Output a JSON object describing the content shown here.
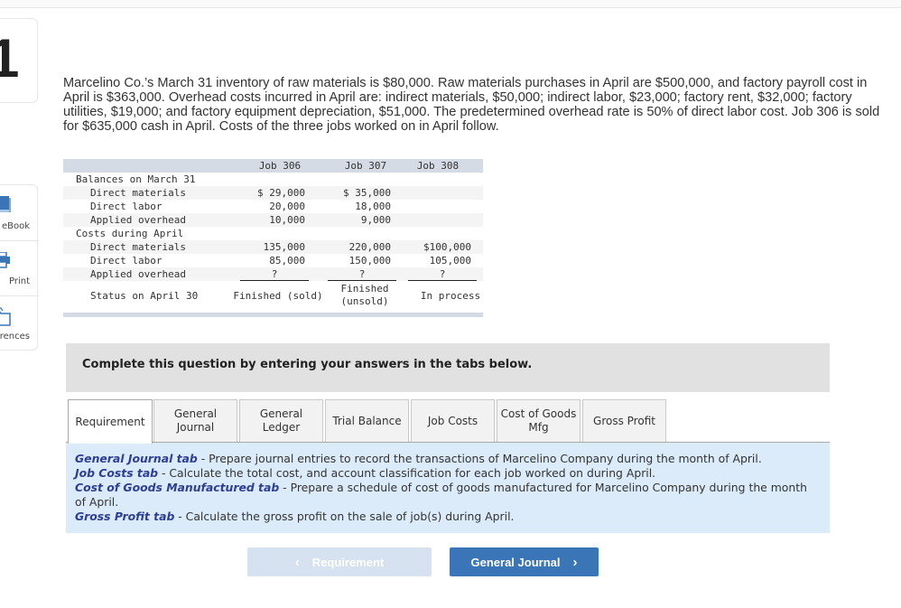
{
  "question": {
    "number": "1",
    "text": "Marcelino Co.’s March 31 inventory of raw materials is $80,000. Raw materials purchases in April are $500,000, and factory payroll cost in April is $363,000. Overhead costs incurred in April are: indirect materials, $50,000; indirect labor, $23,000; factory rent, $32,000; factory utilities, $19,000; and factory equipment depreciation, $51,000. The predetermined overhead rate is 50% of direct labor cost. Job 306 is sold for $635,000 cash in April. Costs of the three jobs worked on in April follow."
  },
  "side_tools": [
    {
      "label": "eBook",
      "icon": "book-icon"
    },
    {
      "label": "Print",
      "icon": "print-icon"
    },
    {
      "label": "References",
      "icon": "references-icon"
    }
  ],
  "job_table": {
    "headers": [
      "Job 306",
      "Job 307",
      "Job 308"
    ],
    "sections": [
      {
        "title": "Balances on March 31",
        "rows": [
          {
            "label": "Direct materials",
            "values": [
              "$ 29,000",
              "$ 35,000",
              ""
            ]
          },
          {
            "label": "Direct labor",
            "values": [
              "20,000",
              "18,000",
              ""
            ]
          },
          {
            "label": "Applied overhead",
            "values": [
              "10,000",
              "9,000",
              ""
            ]
          }
        ]
      },
      {
        "title": "Costs during April",
        "rows": [
          {
            "label": "Direct materials",
            "values": [
              "135,000",
              "220,000",
              "$100,000"
            ]
          },
          {
            "label": "Direct labor",
            "values": [
              "85,000",
              "150,000",
              "105,000"
            ]
          },
          {
            "label": "Applied overhead",
            "values": [
              "?",
              "?",
              "?"
            ]
          }
        ]
      }
    ],
    "status": {
      "label": "Status on April 30",
      "values": [
        "Finished (sold)",
        "Finished\n(unsold)",
        "In process"
      ]
    }
  },
  "instructions": "Complete this question by entering your answers in the tabs below.",
  "tabs": [
    {
      "label": "Requirement",
      "active": true
    },
    {
      "label": "General\nJournal",
      "active": false
    },
    {
      "label": "General\nLedger",
      "active": false
    },
    {
      "label": "Trial Balance",
      "active": false
    },
    {
      "label": "Job Costs",
      "active": false
    },
    {
      "label": "Cost of Goods\nMfg",
      "active": false
    },
    {
      "label": "Gross Profit",
      "active": false
    }
  ],
  "requirements": [
    {
      "tab": "General Journal tab",
      "text": " - Prepare journal entries to record the transactions of Marcelino Company during the month of April."
    },
    {
      "tab": "Job Costs tab",
      "text": " - Calculate the total cost, and account classification for each job worked on during April."
    },
    {
      "tab": "Cost of Goods Manufactured tab",
      "text": " - Prepare a schedule of cost of goods manufactured for Marcelino Company during the month of April."
    },
    {
      "tab": "Gross Profit tab",
      "text": " - Calculate the gross profit on the sale of job(s) during April."
    }
  ],
  "nav": {
    "prev_label": "Requirement",
    "next_label": "General Journal",
    "prev_enabled": false
  },
  "colors": {
    "accent": "#3a76b7",
    "req_tab_name": "#2d3e96",
    "req_panel_bg": "#dbebf9",
    "table_header_bg": "#d5dbe5"
  }
}
